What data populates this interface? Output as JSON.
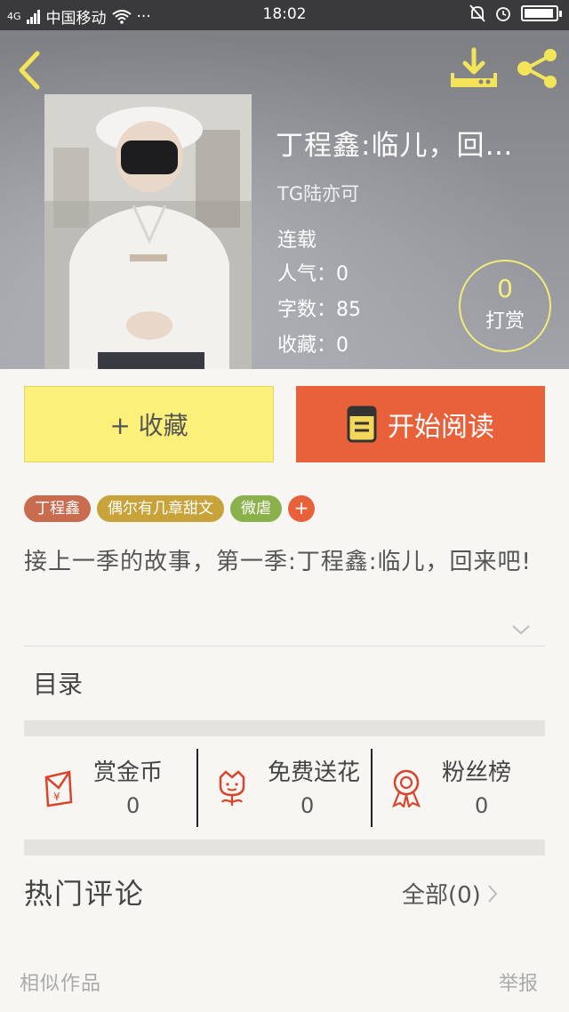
{
  "status_bar": {
    "network": "4G",
    "carrier": "中国移动",
    "dots": "···",
    "time": "18:02"
  },
  "book": {
    "title": "丁程鑫:临儿，回…",
    "author": "TG陆亦可",
    "status": "连载",
    "popularity_label": "人气：",
    "popularity": "0",
    "word_count_label": "字数：",
    "word_count": "85",
    "favorites_label": "收藏：",
    "favorites": "0",
    "reward_count": "0",
    "reward_label": "打赏"
  },
  "actions": {
    "collect_label": "+ 收藏",
    "read_label": "开始阅读"
  },
  "tags": [
    {
      "label": "丁程鑫",
      "color": "#c86b4f"
    },
    {
      "label": "偶尔有几章甜文",
      "color": "#c8a33a"
    },
    {
      "label": "微虐",
      "color": "#8bb14c"
    }
  ],
  "tag_add": "+",
  "synopsis": "接上一季的故事，第一季:丁程鑫:临儿，回来吧!",
  "toc_label": "目录",
  "stats": [
    {
      "label": "赏金币",
      "value": "0",
      "icon": "red-envelope-icon"
    },
    {
      "label": "免费送花",
      "value": "0",
      "icon": "flower-icon"
    },
    {
      "label": "粉丝榜",
      "value": "0",
      "icon": "medal-icon"
    }
  ],
  "comments": {
    "title": "热门评论",
    "all_label": "全部(0)"
  },
  "footer": {
    "similar_label": "相似作品",
    "report_label": "举报"
  },
  "colors": {
    "accent_yellow": "#fbf07a",
    "accent_orange": "#e8613a",
    "icon_red": "#d9442b",
    "header_icons": "#f3e45a"
  }
}
